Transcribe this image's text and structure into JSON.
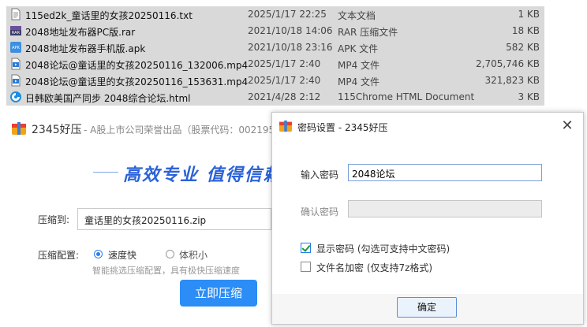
{
  "files": [
    {
      "name": "115ed2k_童话里的女孩20250116.txt",
      "date": "2025/1/17 22:25",
      "type": "文本文档",
      "size": "1 KB",
      "icon": "text-file-icon"
    },
    {
      "name": "2048地址发布器PC版.rar",
      "date": "2021/10/18 14:06",
      "type": "RAR 压缩文件",
      "size": "18 KB",
      "icon": "rar-archive-icon"
    },
    {
      "name": "2048地址发布器手机版.apk",
      "date": "2021/10/18 23:16",
      "type": "APK 文件",
      "size": "582 KB",
      "icon": "apk-file-icon"
    },
    {
      "name": "2048论坛@童话里的女孩20250116_132006.mp4",
      "date": "2025/1/17 2:40",
      "type": "MP4 文件",
      "size": "2,705,746 KB",
      "icon": "video-file-icon"
    },
    {
      "name": "2048论坛@童话里的女孩20250116_153631.mp4",
      "date": "2025/1/17 2:40",
      "type": "MP4 文件",
      "size": "321,823 KB",
      "icon": "video-file-icon"
    },
    {
      "name": "日韩欧美国产同步 2048综合论坛.html",
      "date": "2021/4/28 2:12",
      "type": "115Chrome HTML Document",
      "size": "3 KB",
      "icon": "browser-html-icon"
    }
  ],
  "app": {
    "name": "2345好压",
    "subtitle": "- A股上市公司荣誉出品（股票代码：002195）",
    "slogan": "高效专业  值得信赖",
    "compress_to_label": "压缩到:",
    "compress_to_value": "童话里的女孩20250116.zip",
    "config_label": "压缩配置:",
    "option_fast": "速度快",
    "option_small": "体积小",
    "selected_option": "速度快",
    "hint": "智能挑选压缩配置，具有极快压缩速度",
    "start_button": "立即压缩"
  },
  "dialog": {
    "title": "密码设置 - 2345好压",
    "close_glyph": "✕",
    "password_label": "输入密码",
    "password_value": "2048论坛",
    "confirm_label": "确认密码",
    "confirm_value": "",
    "show_password_label": "显示密码 (勾选可支持中文密码)",
    "show_password_checked": true,
    "encrypt_names_label": "文件名加密  (仅支持7z格式)",
    "encrypt_names_checked": false,
    "ok_button": "确定"
  },
  "colors": {
    "accent": "#2b8df5",
    "slogan": "#2b62d8",
    "row_highlight": "#d9d9d9",
    "hint": "#999999"
  }
}
